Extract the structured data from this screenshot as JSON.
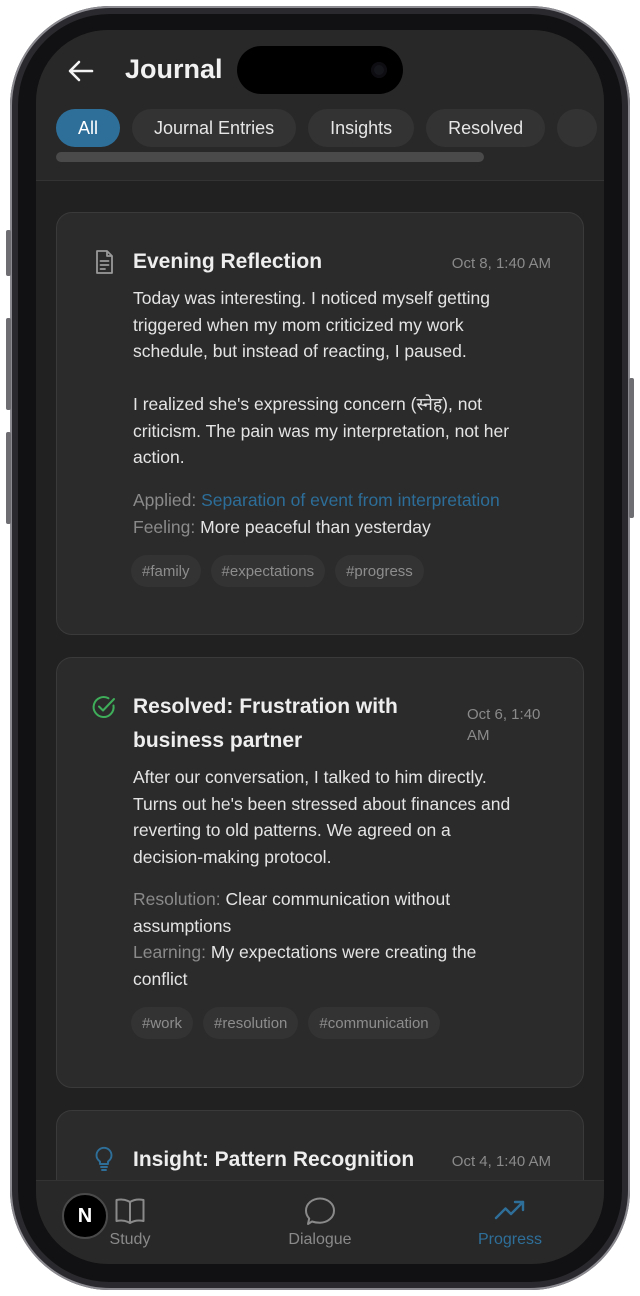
{
  "header": {
    "title": "Journal"
  },
  "tabs": [
    {
      "label": "All",
      "active": true
    },
    {
      "label": "Journal Entries",
      "active": false
    },
    {
      "label": "Insights",
      "active": false
    },
    {
      "label": "Resolved",
      "active": false
    }
  ],
  "cards": [
    {
      "icon": "document-icon",
      "title": "Evening Reflection",
      "time": "Oct 8, 1:40 AM",
      "body_lines": [
        "Today was interesting. I noticed myself getting",
        "triggered when my mom criticized my work",
        "schedule, but instead of reacting, I paused.",
        "",
        "I realized she's expressing concern (स्नेह), not",
        "criticism. The pain was my interpretation, not her",
        "action."
      ],
      "meta": [
        {
          "label": "Applied:",
          "value": "Separation of event from interpretation",
          "style": "link"
        },
        {
          "label": "Feeling:",
          "value": "More peaceful than yesterday",
          "style": "plain"
        }
      ],
      "tags": [
        "#family",
        "#expectations",
        "#progress"
      ]
    },
    {
      "icon": "check-circle-icon",
      "title_lines": [
        "Resolved: Frustration with",
        "business partner"
      ],
      "time_lines": [
        "Oct 6, 1:40",
        "AM"
      ],
      "body_lines": [
        "After our conversation, I talked to him directly.",
        "Turns out he's been stressed about finances and",
        "reverting to old patterns. We agreed on a",
        "decision-making protocol."
      ],
      "meta": [
        {
          "label": "Resolution:",
          "value_lines": [
            "Clear communication without",
            "assumptions"
          ]
        },
        {
          "label": "Learning:",
          "value_lines": [
            "My expectations were creating the",
            "conflict"
          ]
        }
      ],
      "tags": [
        "#work",
        "#resolution",
        "#communication"
      ]
    },
    {
      "icon": "lightbulb-icon",
      "title": "Insight: Pattern Recognition",
      "time": "Oct 4, 1:40 AM"
    }
  ],
  "bottom_nav": {
    "avatar_letter": "N",
    "items": [
      {
        "label": "Study",
        "icon": "book-icon",
        "active": false
      },
      {
        "label": "Dialogue",
        "icon": "chat-bubble-icon",
        "active": false
      },
      {
        "label": "Progress",
        "icon": "trending-up-icon",
        "active": true
      }
    ]
  },
  "colors": {
    "accent": "#2e6f9a",
    "success": "#3fae5a",
    "background": "#212121",
    "card": "#2b2b2b"
  }
}
